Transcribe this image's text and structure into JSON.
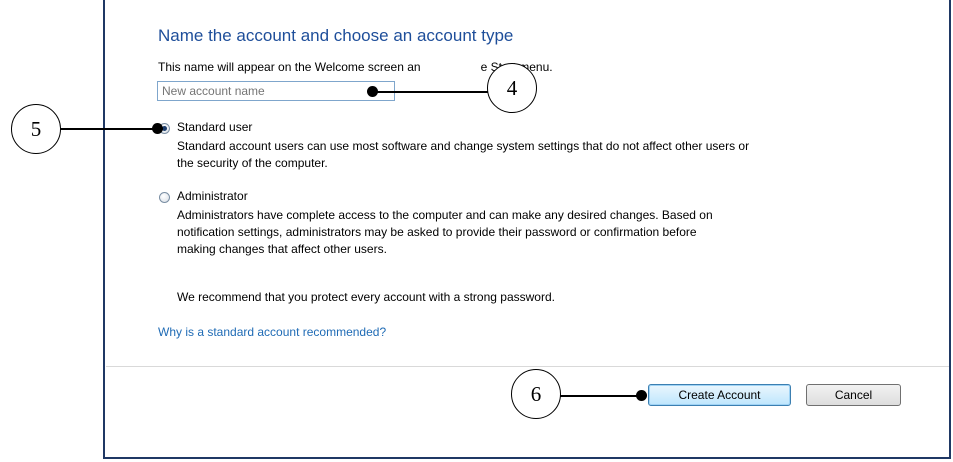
{
  "dialog": {
    "title": "Name the account and choose an account type",
    "subtitle_part1": "This name will appear on the Welcome screen an",
    "subtitle_part2": "e Start menu.",
    "name_placeholder": "New account name"
  },
  "options": {
    "standard": {
      "label": "Standard user",
      "desc_line1": "Standard account users can use most software and change system settings that do not affect other users or",
      "desc_line2": "the security of the computer.",
      "selected": true
    },
    "admin": {
      "label": "Administrator",
      "desc_line1": "Administrators have complete access to the computer and can make any desired changes. Based on",
      "desc_line2": "notification settings, administrators may be asked to provide their password or confirmation before",
      "desc_line3": "making changes that affect other users.",
      "selected": false
    }
  },
  "recommend_text": "We recommend that you protect every account with a strong password.",
  "help_link": "Why is a standard account recommended?",
  "buttons": {
    "create": "Create Account",
    "cancel": "Cancel"
  },
  "callouts": [
    "4",
    "5",
    "6"
  ],
  "colors": {
    "title": "#1e4e9a",
    "link": "#1f6bb5",
    "frame": "#1f3864"
  }
}
